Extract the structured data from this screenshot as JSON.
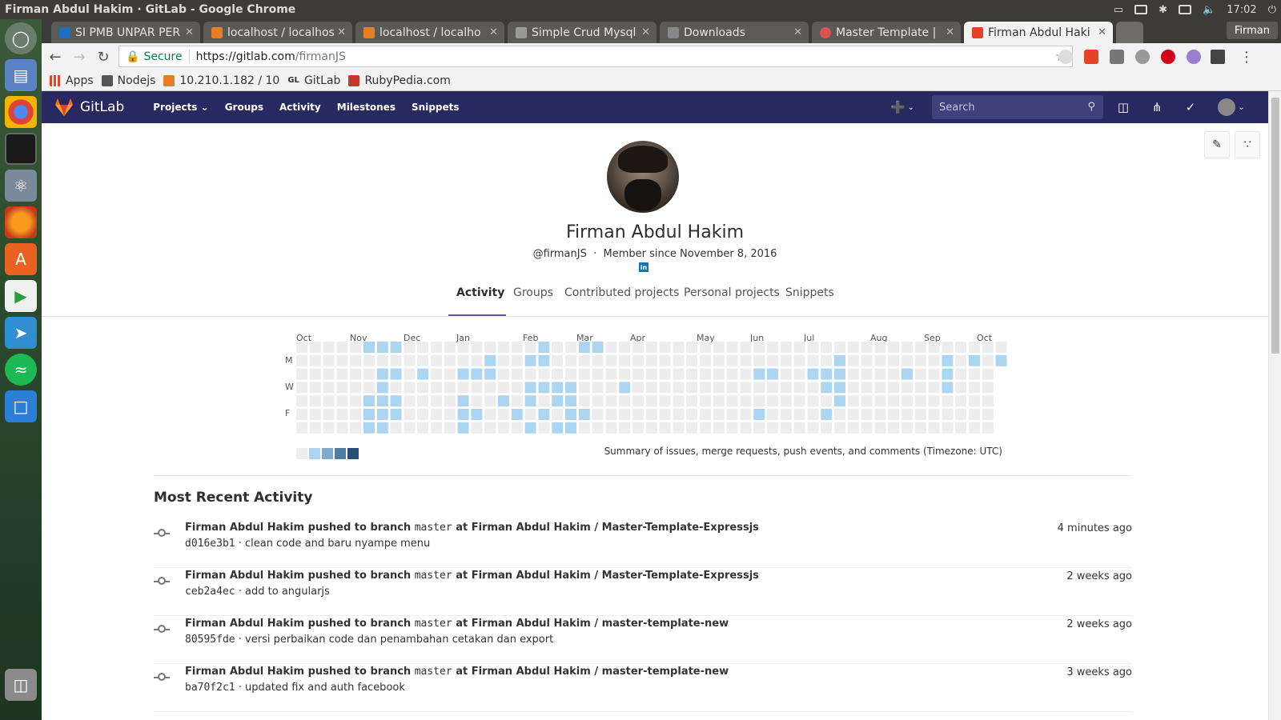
{
  "os": {
    "window_title": "Firman Abdul Hakim · GitLab - Google Chrome",
    "clock": "17:02"
  },
  "browser": {
    "tabs": [
      {
        "label": "SI PMB UNPAR PER",
        "favicon_color": "#1e6fbf"
      },
      {
        "label": "localhost / localhos",
        "favicon_color": "#e67e22"
      },
      {
        "label": "localhost / localho",
        "favicon_color": "#e67e22"
      },
      {
        "label": "Simple Crud Mysql",
        "favicon_color": "#999999"
      },
      {
        "label": "Downloads",
        "favicon_color": "#888888"
      },
      {
        "label": "Master Template |",
        "favicon_color": "#d9534f"
      },
      {
        "label": "Firman Abdul Haki",
        "favicon_color": "#e24329"
      }
    ],
    "profile": "Firman",
    "secure_label": "Secure",
    "url_host": "https://gitlab.com",
    "url_path": "/firmanJS",
    "bookmarks": [
      {
        "label": "Apps",
        "icon": "apps-grid-icon"
      },
      {
        "label": "Nodejs",
        "icon": "folder-icon"
      },
      {
        "label": "10.210.1.182 / 10",
        "icon": "pma-icon"
      },
      {
        "label": "GitLab",
        "icon": "gl-icon"
      },
      {
        "label": "RubyPedia.com",
        "icon": "ruby-icon"
      }
    ]
  },
  "gitlab": {
    "brand": "GitLab",
    "nav": [
      "Projects",
      "Groups",
      "Activity",
      "Milestones",
      "Snippets"
    ],
    "search_placeholder": "Search",
    "colors": {
      "header": "#292961",
      "accent": "#6b4fbb"
    }
  },
  "profile": {
    "name": "Firman Abdul Hakim",
    "username": "@firmanJS",
    "member_since": "Member since November 8, 2016",
    "social_label": "in",
    "tabs": [
      "Activity",
      "Groups",
      "Contributed projects",
      "Personal projects",
      "Snippets"
    ],
    "active_tab": "Activity"
  },
  "calendar": {
    "months": [
      "Oct",
      "Nov",
      "Dec",
      "Jan",
      "Feb",
      "Mar",
      "Apr",
      "May",
      "Jun",
      "Jul",
      "Aug",
      "Sep",
      "Oct"
    ],
    "day_labels": [
      "M",
      "W",
      "F"
    ],
    "legend_colors": [
      "#ededed",
      "#acd5f2",
      "#7fa8c9",
      "#527ba0",
      "#254e77"
    ],
    "summary": "Summary of issues, merge requests, push events, and comments (Timezone: UTC)",
    "weeks": 53,
    "active_cells": [
      [
        5,
        0
      ],
      [
        6,
        0
      ],
      [
        7,
        0
      ],
      [
        18,
        0
      ],
      [
        21,
        0
      ],
      [
        22,
        0
      ],
      [
        14,
        1
      ],
      [
        17,
        1
      ],
      [
        18,
        1
      ],
      [
        40,
        1
      ],
      [
        48,
        1
      ],
      [
        50,
        1
      ],
      [
        52,
        1
      ],
      [
        6,
        2
      ],
      [
        7,
        2
      ],
      [
        9,
        2
      ],
      [
        12,
        2
      ],
      [
        13,
        2
      ],
      [
        14,
        2
      ],
      [
        34,
        2
      ],
      [
        35,
        2
      ],
      [
        38,
        2
      ],
      [
        39,
        2
      ],
      [
        40,
        2
      ],
      [
        45,
        2
      ],
      [
        48,
        2
      ],
      [
        6,
        3
      ],
      [
        17,
        3
      ],
      [
        18,
        3
      ],
      [
        19,
        3
      ],
      [
        20,
        3
      ],
      [
        24,
        3
      ],
      [
        39,
        3
      ],
      [
        40,
        3
      ],
      [
        48,
        3
      ],
      [
        5,
        4
      ],
      [
        6,
        4
      ],
      [
        7,
        4
      ],
      [
        12,
        4
      ],
      [
        15,
        4
      ],
      [
        17,
        4
      ],
      [
        19,
        4
      ],
      [
        20,
        4
      ],
      [
        40,
        4
      ],
      [
        5,
        5
      ],
      [
        6,
        5
      ],
      [
        7,
        5
      ],
      [
        12,
        5
      ],
      [
        13,
        5
      ],
      [
        16,
        5
      ],
      [
        18,
        5
      ],
      [
        20,
        5
      ],
      [
        21,
        5
      ],
      [
        34,
        5
      ],
      [
        39,
        5
      ],
      [
        5,
        6
      ],
      [
        6,
        6
      ],
      [
        12,
        6
      ],
      [
        17,
        6
      ],
      [
        19,
        6
      ],
      [
        20,
        6
      ]
    ]
  },
  "activity": {
    "title": "Most Recent Activity",
    "events": [
      {
        "author": "Firman Abdul Hakim",
        "action": "pushed to branch",
        "branch": "master",
        "at": "at",
        "project": "Firman Abdul Hakim / Master-Template-Expressjs",
        "sha": "d016e3b1",
        "message": "· clean code and baru nyampe menu",
        "time": "4 minutes ago"
      },
      {
        "author": "Firman Abdul Hakim",
        "action": "pushed to branch",
        "branch": "master",
        "at": "at",
        "project": "Firman Abdul Hakim / Master-Template-Expressjs",
        "sha": "ceb2a4ec",
        "message": "· add to angularjs",
        "time": "2 weeks ago"
      },
      {
        "author": "Firman Abdul Hakim",
        "action": "pushed to branch",
        "branch": "master",
        "at": "at",
        "project": "Firman Abdul Hakim / master-template-new",
        "sha": "80595fde",
        "message": "· versi perbaikan code dan penambahan cetakan dan export",
        "time": "2 weeks ago"
      },
      {
        "author": "Firman Abdul Hakim",
        "action": "pushed to branch",
        "branch": "master",
        "at": "at",
        "project": "Firman Abdul Hakim / master-template-new",
        "sha": "ba70f2c1",
        "message": "· updated fix and auth facebook",
        "time": "3 weeks ago"
      }
    ]
  }
}
